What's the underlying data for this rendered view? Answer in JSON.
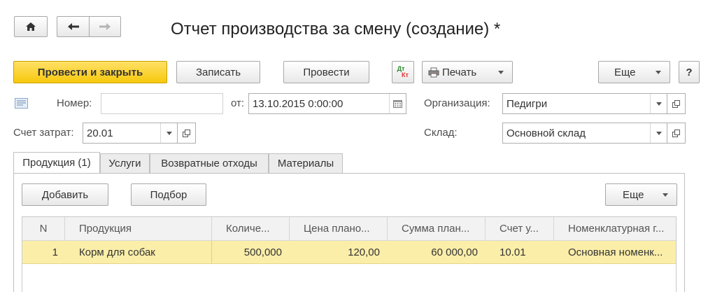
{
  "window": {
    "title": "Отчет производства за смену (создание) *"
  },
  "toolbar": {
    "post_close_label": "Провести и закрыть",
    "save_label": "Записать",
    "post_label": "Провести",
    "dt_kt_top": "Дт",
    "dt_kt_bottom": "Кт",
    "print_label": "Печать",
    "more_label": "Еще",
    "help_label": "?"
  },
  "form": {
    "number_label": "Номер:",
    "number_value": "",
    "date_label": "от:",
    "date_value": "13.10.2015  0:00:00",
    "org_label": "Организация:",
    "org_value": "Педигри",
    "cost_account_label": "Счет затрат:",
    "cost_account_value": "20.01",
    "warehouse_label": "Склад:",
    "warehouse_value": "Основной склад"
  },
  "tabs": [
    {
      "label": "Продукция (1)"
    },
    {
      "label": "Услуги"
    },
    {
      "label": "Возвратные отходы"
    },
    {
      "label": "Материалы"
    }
  ],
  "table_toolbar": {
    "add_label": "Добавить",
    "pick_label": "Подбор",
    "more_label": "Еще"
  },
  "table": {
    "columns": [
      "N",
      "Продукция",
      "Количе...",
      "Цена плано...",
      "Сумма план...",
      "Счет у...",
      "Номенклатурная г..."
    ],
    "rows": [
      [
        "1",
        "Корм для собак",
        "500,000",
        "120,00",
        "60 000,00",
        "10.01",
        "Основная номенк..."
      ]
    ]
  }
}
